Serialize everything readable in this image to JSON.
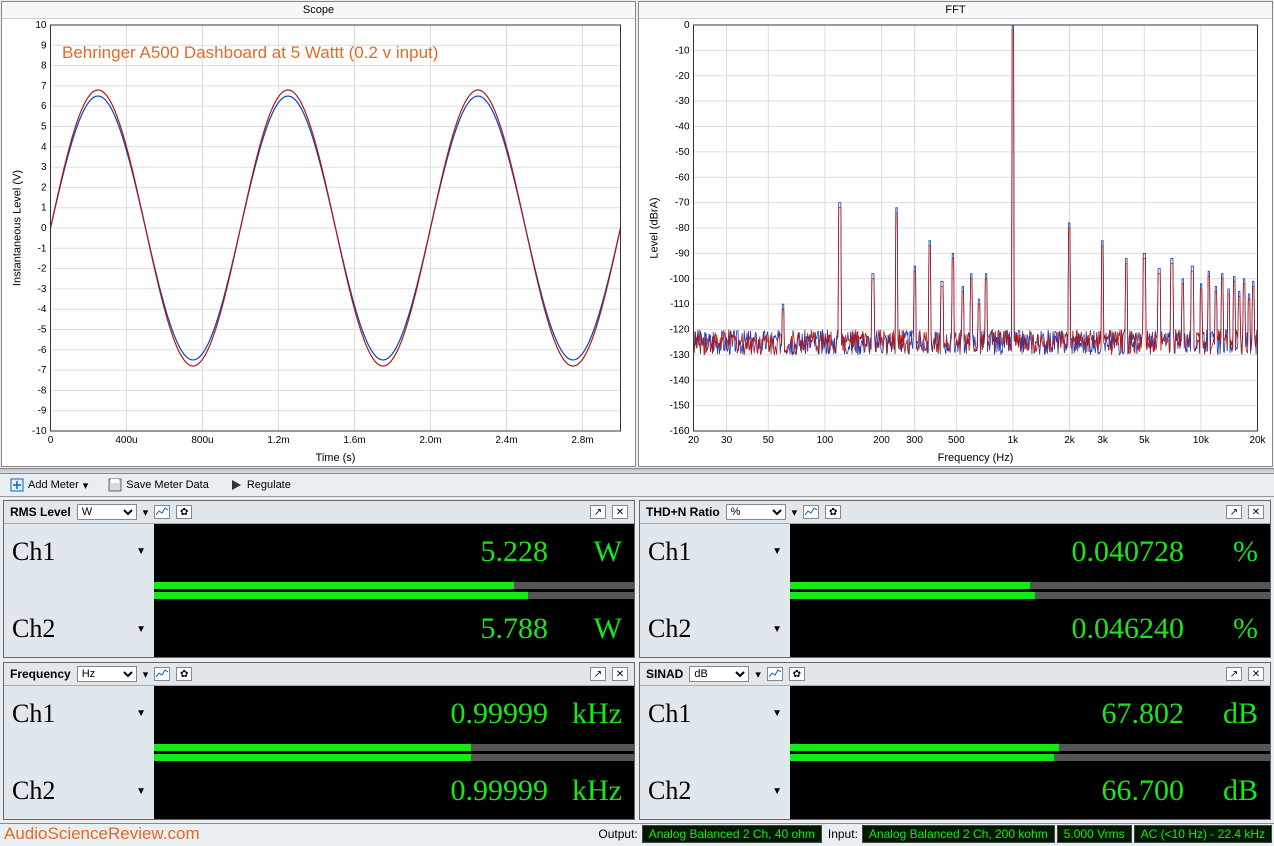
{
  "annotation": "Behringer A500 Dashboard at 5 Wattt (0.2 v input)",
  "watermark": "AudioScienceReview.com",
  "toolbar": {
    "add_meter": "Add Meter",
    "save_meter": "Save Meter Data",
    "regulate": "Regulate"
  },
  "chart_data": [
    {
      "type": "line",
      "title": "Scope",
      "xlabel": "Time (s)",
      "ylabel": "Instantaneous Level (V)",
      "x_ticks": [
        "0",
        "400u",
        "800u",
        "1.2m",
        "1.6m",
        "2.0m",
        "2.4m",
        "2.8m"
      ],
      "y_ticks": [
        -10,
        -9,
        -8,
        -7,
        -6,
        -5,
        -4,
        -3,
        -2,
        -1,
        0,
        1,
        2,
        3,
        4,
        5,
        6,
        7,
        8,
        9,
        10
      ],
      "xlim": [
        0,
        0.003
      ],
      "ylim": [
        -10,
        10
      ],
      "series": [
        {
          "name": "Ch1",
          "color": "#1040c0",
          "amplitude": 6.5,
          "freq_hz": 1000,
          "phase": 0
        },
        {
          "name": "Ch2",
          "color": "#b01818",
          "amplitude": 6.8,
          "freq_hz": 1000,
          "phase": 0
        }
      ]
    },
    {
      "type": "line",
      "title": "FFT",
      "xlabel": "Frequency (Hz)",
      "ylabel": "Level (dBrA)",
      "x_scale": "log",
      "x_ticks": [
        "20",
        "30",
        "50",
        "100",
        "200",
        "300",
        "500",
        "1k",
        "2k",
        "3k",
        "5k",
        "10k",
        "20k"
      ],
      "y_ticks": [
        0,
        -10,
        -20,
        -30,
        -40,
        -50,
        -60,
        -70,
        -80,
        -90,
        -100,
        -110,
        -120,
        -130,
        -140,
        -150,
        -160
      ],
      "xlim": [
        20,
        20000
      ],
      "ylim": [
        -160,
        0
      ],
      "noise_floor_db": -125,
      "series": [
        {
          "name": "Ch1",
          "color": "#1040c0"
        },
        {
          "name": "Ch2",
          "color": "#b01818"
        }
      ],
      "peaks": [
        {
          "f": 60,
          "db": -110
        },
        {
          "f": 120,
          "db": -70
        },
        {
          "f": 180,
          "db": -98
        },
        {
          "f": 240,
          "db": -72
        },
        {
          "f": 300,
          "db": -95
        },
        {
          "f": 360,
          "db": -85
        },
        {
          "f": 420,
          "db": -101
        },
        {
          "f": 480,
          "db": -90
        },
        {
          "f": 540,
          "db": -103
        },
        {
          "f": 600,
          "db": -98
        },
        {
          "f": 660,
          "db": -108
        },
        {
          "f": 720,
          "db": -98
        },
        {
          "f": 1000,
          "db": 0
        },
        {
          "f": 2000,
          "db": -78
        },
        {
          "f": 3000,
          "db": -85
        },
        {
          "f": 4000,
          "db": -92
        },
        {
          "f": 5000,
          "db": -90
        },
        {
          "f": 6000,
          "db": -96
        },
        {
          "f": 7000,
          "db": -92
        },
        {
          "f": 8000,
          "db": -100
        },
        {
          "f": 9000,
          "db": -95
        },
        {
          "f": 10000,
          "db": -102
        },
        {
          "f": 11000,
          "db": -97
        },
        {
          "f": 12000,
          "db": -103
        },
        {
          "f": 13000,
          "db": -98
        },
        {
          "f": 14000,
          "db": -104
        },
        {
          "f": 15000,
          "db": -99
        },
        {
          "f": 16000,
          "db": -105
        },
        {
          "f": 17000,
          "db": -100
        },
        {
          "f": 18000,
          "db": -106
        },
        {
          "f": 19000,
          "db": -101
        }
      ]
    }
  ],
  "meters": {
    "rms": {
      "title": "RMS Level",
      "unit_sel": "W",
      "ch1": {
        "label": "Ch1",
        "value": "5.228",
        "unit": "W",
        "bar": 0.75
      },
      "ch2": {
        "label": "Ch2",
        "value": "5.788",
        "unit": "W",
        "bar": 0.78
      }
    },
    "thdn": {
      "title": "THD+N Ratio",
      "unit_sel": "%",
      "ch1": {
        "label": "Ch1",
        "value": "0.040728",
        "unit": "%",
        "bar": 0.5
      },
      "ch2": {
        "label": "Ch2",
        "value": "0.046240",
        "unit": "%",
        "bar": 0.51
      }
    },
    "freq": {
      "title": "Frequency",
      "unit_sel": "Hz",
      "ch1": {
        "label": "Ch1",
        "value": "0.99999",
        "unit": "kHz",
        "bar": 0.66
      },
      "ch2": {
        "label": "Ch2",
        "value": "0.99999",
        "unit": "kHz",
        "bar": 0.66
      }
    },
    "sinad": {
      "title": "SINAD",
      "unit_sel": "dB",
      "ch1": {
        "label": "Ch1",
        "value": "67.802",
        "unit": "dB",
        "bar": 0.56
      },
      "ch2": {
        "label": "Ch2",
        "value": "66.700",
        "unit": "dB",
        "bar": 0.55
      }
    }
  },
  "status": {
    "output_label": "Output:",
    "output_value": "Analog Balanced 2 Ch, 40 ohm",
    "input_label": "Input:",
    "input_value": "Analog Balanced 2 Ch, 200 kohm",
    "vrms": "5.000 Vrms",
    "bw": "AC (<10 Hz) - 22.4 kHz"
  }
}
